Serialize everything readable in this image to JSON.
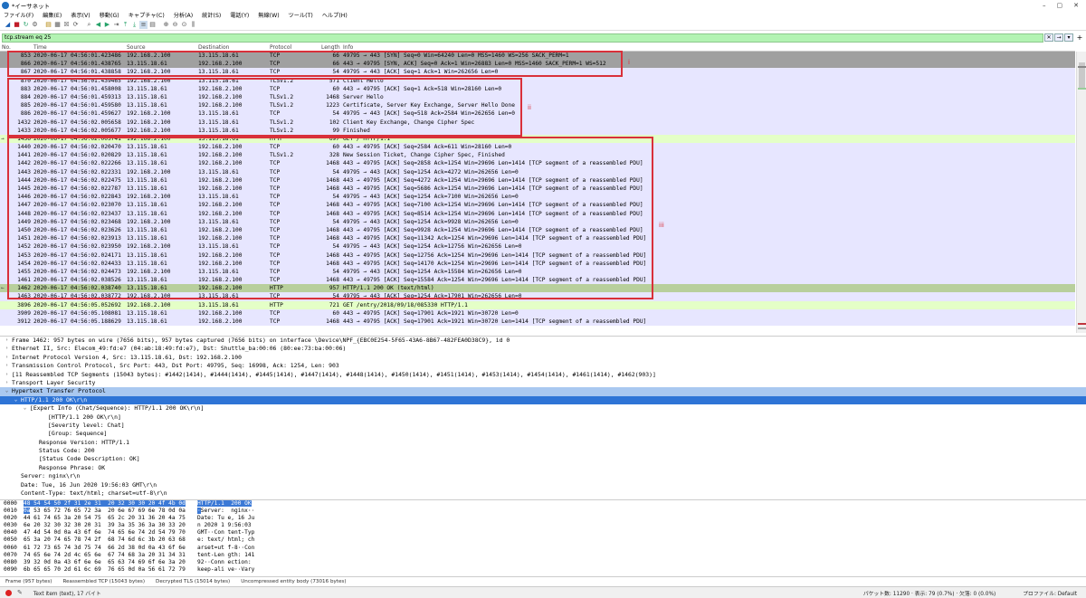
{
  "window": {
    "title": "*イーサネット",
    "controls": [
      "–",
      "▢",
      "✕"
    ]
  },
  "menu": [
    "ファイル(F)",
    "編集(E)",
    "表示(V)",
    "移動(G)",
    "キャプチャ(C)",
    "分析(A)",
    "統計(S)",
    "電話(Y)",
    "無線(W)",
    "ツール(T)",
    "ヘルプ(H)"
  ],
  "filter": {
    "value": "tcp.stream eq 25",
    "expression_label": "+"
  },
  "columns": {
    "no": "No.",
    "time": "Time",
    "source": "Source",
    "destination": "Destination",
    "protocol": "Protocol",
    "length": "Length",
    "info": "Info"
  },
  "colors": {
    "tcp_syn_row": "#a0a0a0",
    "tcp_row": "#e7e6ff",
    "http_row": "#e4ffc7",
    "http_selected": "#b8cf9c",
    "annotation": "#d9303a",
    "filter_ok": "#b3f3b3",
    "detail_selected": "#2e74d6",
    "detail_highlight": "#a9c8f0"
  },
  "packets": [
    {
      "mark": "",
      "no": "853",
      "time": "2020-06-17 04:56:01.423486",
      "src": "192.168.2.100",
      "dst": "13.115.18.61",
      "proto": "TCP",
      "len": "66",
      "info": "49795 → 443 [SYN] Seq=0 Win=64240 Len=0 MSS=1460 WS=256 SACK_PERM=1",
      "bg": "#a0a0a0"
    },
    {
      "mark": "",
      "no": "866",
      "time": "2020-06-17 04:56:01.438765",
      "src": "13.115.18.61",
      "dst": "192.168.2.100",
      "proto": "TCP",
      "len": "66",
      "info": "443 → 49795 [SYN, ACK] Seq=0 Ack=1 Win=26883 Len=0 MSS=1460 SACK_PERM=1 WS=512",
      "bg": "#a0a0a0"
    },
    {
      "mark": "",
      "no": "867",
      "time": "2020-06-17 04:56:01.438858",
      "src": "192.168.2.100",
      "dst": "13.115.18.61",
      "proto": "TCP",
      "len": "54",
      "info": "49795 → 443 [ACK] Seq=1 Ack=1 Win=262656 Len=0",
      "bg": "#e7e6ff"
    },
    {
      "mark": "",
      "no": "870",
      "time": "2020-06-17 04:56:01.439465",
      "src": "192.168.2.100",
      "dst": "13.115.18.61",
      "proto": "TLSv1.2",
      "len": "571",
      "info": "Client Hello",
      "bg": "#e7e6ff"
    },
    {
      "mark": "",
      "no": "883",
      "time": "2020-06-17 04:56:01.458008",
      "src": "13.115.18.61",
      "dst": "192.168.2.100",
      "proto": "TCP",
      "len": "60",
      "info": "443 → 49795 [ACK] Seq=1 Ack=518 Win=28160 Len=0",
      "bg": "#e7e6ff"
    },
    {
      "mark": "",
      "no": "884",
      "time": "2020-06-17 04:56:01.459313",
      "src": "13.115.18.61",
      "dst": "192.168.2.100",
      "proto": "TLSv1.2",
      "len": "1468",
      "info": "Server Hello",
      "bg": "#e7e6ff"
    },
    {
      "mark": "",
      "no": "885",
      "time": "2020-06-17 04:56:01.459580",
      "src": "13.115.18.61",
      "dst": "192.168.2.100",
      "proto": "TLSv1.2",
      "len": "1223",
      "info": "Certificate, Server Key Exchange, Server Hello Done",
      "bg": "#e7e6ff"
    },
    {
      "mark": "",
      "no": "886",
      "time": "2020-06-17 04:56:01.459627",
      "src": "192.168.2.100",
      "dst": "13.115.18.61",
      "proto": "TCP",
      "len": "54",
      "info": "49795 → 443 [ACK] Seq=518 Ack=2584 Win=262656 Len=0",
      "bg": "#e7e6ff"
    },
    {
      "mark": "",
      "no": "1432",
      "time": "2020-06-17 04:56:02.005658",
      "src": "192.168.2.100",
      "dst": "13.115.18.61",
      "proto": "TLSv1.2",
      "len": "102",
      "info": "Client Key Exchange, Change Cipher Spec",
      "bg": "#e7e6ff"
    },
    {
      "mark": "",
      "no": "1433",
      "time": "2020-06-17 04:56:02.005677",
      "src": "192.168.2.100",
      "dst": "13.115.18.61",
      "proto": "TLSv1.2",
      "len": "99",
      "info": "Finished",
      "bg": "#e7e6ff"
    },
    {
      "mark": "→",
      "no": "1436",
      "time": "2020-06-17 04:56:02.005741",
      "src": "192.168.2.100",
      "dst": "13.115.18.61",
      "proto": "HTTP",
      "len": "697",
      "info": "GET / HTTP/1.1",
      "bg": "#e4ffc7"
    },
    {
      "mark": "",
      "no": "1440",
      "time": "2020-06-17 04:56:02.020470",
      "src": "13.115.18.61",
      "dst": "192.168.2.100",
      "proto": "TCP",
      "len": "60",
      "info": "443 → 49795 [ACK] Seq=2584 Ack=611 Win=28160 Len=0",
      "bg": "#e7e6ff"
    },
    {
      "mark": "",
      "no": "1441",
      "time": "2020-06-17 04:56:02.020829",
      "src": "13.115.18.61",
      "dst": "192.168.2.100",
      "proto": "TLSv1.2",
      "len": "328",
      "info": "New Session Ticket, Change Cipher Spec, Finished",
      "bg": "#e7e6ff"
    },
    {
      "mark": "",
      "no": "1442",
      "time": "2020-06-17 04:56:02.022266",
      "src": "13.115.18.61",
      "dst": "192.168.2.100",
      "proto": "TCP",
      "len": "1468",
      "info": "443 → 49795 [ACK] Seq=2858 Ack=1254 Win=29696 Len=1414 [TCP segment of a reassembled PDU]",
      "bg": "#e7e6ff"
    },
    {
      "mark": "",
      "no": "1443",
      "time": "2020-06-17 04:56:02.022331",
      "src": "192.168.2.100",
      "dst": "13.115.18.61",
      "proto": "TCP",
      "len": "54",
      "info": "49795 → 443 [ACK] Seq=1254 Ack=4272 Win=262656 Len=0",
      "bg": "#e7e6ff"
    },
    {
      "mark": "",
      "no": "1444",
      "time": "2020-06-17 04:56:02.022475",
      "src": "13.115.18.61",
      "dst": "192.168.2.100",
      "proto": "TCP",
      "len": "1468",
      "info": "443 → 49795 [ACK] Seq=4272 Ack=1254 Win=29696 Len=1414 [TCP segment of a reassembled PDU]",
      "bg": "#e7e6ff"
    },
    {
      "mark": "",
      "no": "1445",
      "time": "2020-06-17 04:56:02.022787",
      "src": "13.115.18.61",
      "dst": "192.168.2.100",
      "proto": "TCP",
      "len": "1468",
      "info": "443 → 49795 [ACK] Seq=5686 Ack=1254 Win=29696 Len=1414 [TCP segment of a reassembled PDU]",
      "bg": "#e7e6ff"
    },
    {
      "mark": "",
      "no": "1446",
      "time": "2020-06-17 04:56:02.022843",
      "src": "192.168.2.100",
      "dst": "13.115.18.61",
      "proto": "TCP",
      "len": "54",
      "info": "49795 → 443 [ACK] Seq=1254 Ack=7100 Win=262656 Len=0",
      "bg": "#e7e6ff"
    },
    {
      "mark": "",
      "no": "1447",
      "time": "2020-06-17 04:56:02.023070",
      "src": "13.115.18.61",
      "dst": "192.168.2.100",
      "proto": "TCP",
      "len": "1468",
      "info": "443 → 49795 [ACK] Seq=7100 Ack=1254 Win=29696 Len=1414 [TCP segment of a reassembled PDU]",
      "bg": "#e7e6ff"
    },
    {
      "mark": "",
      "no": "1448",
      "time": "2020-06-17 04:56:02.023437",
      "src": "13.115.18.61",
      "dst": "192.168.2.100",
      "proto": "TCP",
      "len": "1468",
      "info": "443 → 49795 [ACK] Seq=8514 Ack=1254 Win=29696 Len=1414 [TCP segment of a reassembled PDU]",
      "bg": "#e7e6ff"
    },
    {
      "mark": "",
      "no": "1449",
      "time": "2020-06-17 04:56:02.023468",
      "src": "192.168.2.100",
      "dst": "13.115.18.61",
      "proto": "TCP",
      "len": "54",
      "info": "49795 → 443 [ACK] Seq=1254 Ack=9928 Win=262656 Len=0",
      "bg": "#e7e6ff"
    },
    {
      "mark": "",
      "no": "1450",
      "time": "2020-06-17 04:56:02.023626",
      "src": "13.115.18.61",
      "dst": "192.168.2.100",
      "proto": "TCP",
      "len": "1468",
      "info": "443 → 49795 [ACK] Seq=9928 Ack=1254 Win=29696 Len=1414 [TCP segment of a reassembled PDU]",
      "bg": "#e7e6ff"
    },
    {
      "mark": "",
      "no": "1451",
      "time": "2020-06-17 04:56:02.023913",
      "src": "13.115.18.61",
      "dst": "192.168.2.100",
      "proto": "TCP",
      "len": "1468",
      "info": "443 → 49795 [ACK] Seq=11342 Ack=1254 Win=29696 Len=1414 [TCP segment of a reassembled PDU]",
      "bg": "#e7e6ff"
    },
    {
      "mark": "",
      "no": "1452",
      "time": "2020-06-17 04:56:02.023950",
      "src": "192.168.2.100",
      "dst": "13.115.18.61",
      "proto": "TCP",
      "len": "54",
      "info": "49795 → 443 [ACK] Seq=1254 Ack=12756 Win=262656 Len=0",
      "bg": "#e7e6ff"
    },
    {
      "mark": "",
      "no": "1453",
      "time": "2020-06-17 04:56:02.024171",
      "src": "13.115.18.61",
      "dst": "192.168.2.100",
      "proto": "TCP",
      "len": "1468",
      "info": "443 → 49795 [ACK] Seq=12756 Ack=1254 Win=29696 Len=1414 [TCP segment of a reassembled PDU]",
      "bg": "#e7e6ff"
    },
    {
      "mark": "",
      "no": "1454",
      "time": "2020-06-17 04:56:02.024433",
      "src": "13.115.18.61",
      "dst": "192.168.2.100",
      "proto": "TCP",
      "len": "1468",
      "info": "443 → 49795 [ACK] Seq=14170 Ack=1254 Win=29696 Len=1414 [TCP segment of a reassembled PDU]",
      "bg": "#e7e6ff"
    },
    {
      "mark": "",
      "no": "1455",
      "time": "2020-06-17 04:56:02.024473",
      "src": "192.168.2.100",
      "dst": "13.115.18.61",
      "proto": "TCP",
      "len": "54",
      "info": "49795 → 443 [ACK] Seq=1254 Ack=15584 Win=262656 Len=0",
      "bg": "#e7e6ff"
    },
    {
      "mark": "",
      "no": "1461",
      "time": "2020-06-17 04:56:02.038526",
      "src": "13.115.18.61",
      "dst": "192.168.2.100",
      "proto": "TCP",
      "len": "1468",
      "info": "443 → 49795 [ACK] Seq=15584 Ack=1254 Win=29696 Len=1414 [TCP segment of a reassembled PDU]",
      "bg": "#e7e6ff"
    },
    {
      "mark": "←",
      "no": "1462",
      "time": "2020-06-17 04:56:02.038740",
      "src": "13.115.18.61",
      "dst": "192.168.2.100",
      "proto": "HTTP",
      "len": "957",
      "info": "HTTP/1.1 200 OK  (text/html)",
      "bg": "#b8cf9c"
    },
    {
      "mark": "",
      "no": "1463",
      "time": "2020-06-17 04:56:02.038772",
      "src": "192.168.2.100",
      "dst": "13.115.18.61",
      "proto": "TCP",
      "len": "54",
      "info": "49795 → 443 [ACK] Seq=1254 Ack=17901 Win=262656 Len=0",
      "bg": "#e7e6ff"
    },
    {
      "mark": "",
      "no": "3896",
      "time": "2020-06-17 04:56:05.052692",
      "src": "192.168.2.100",
      "dst": "13.115.18.61",
      "proto": "HTTP",
      "len": "721",
      "info": "GET /entry/2018/09/18/085330 HTTP/1.1",
      "bg": "#e4ffc7"
    },
    {
      "mark": "",
      "no": "3909",
      "time": "2020-06-17 04:56:05.108081",
      "src": "13.115.18.61",
      "dst": "192.168.2.100",
      "proto": "TCP",
      "len": "60",
      "info": "443 → 49795 [ACK] Seq=17901 Ack=1921 Win=30720 Len=0",
      "bg": "#e7e6ff"
    },
    {
      "mark": "",
      "no": "3912",
      "time": "2020-06-17 04:56:05.188629",
      "src": "13.115.18.61",
      "dst": "192.168.2.100",
      "proto": "TCP",
      "len": "1468",
      "info": "443 → 49795 [ACK] Seq=17901 Ack=1921 Win=30720 Len=1414 [TCP segment of a reassembled PDU]",
      "bg": "#e7e6ff"
    }
  ],
  "annotations": [
    {
      "label": "i"
    },
    {
      "label": "ii"
    },
    {
      "label": "iii"
    }
  ],
  "details": [
    {
      "tw": "›",
      "indent": 0,
      "text": "Frame 1462: 957 bytes on wire (7656 bits), 957 bytes captured (7656 bits) on interface \\Device\\NPF_{EBC0E254-5F65-43A6-8B67-482FEA0D38C9}, id 0",
      "style": ""
    },
    {
      "tw": "›",
      "indent": 0,
      "text": "Ethernet II, Src: Elecom_49:fd:e7 (04:ab:18:49:fd:e7), Dst: Shuttle_ba:00:06 (80:ee:73:ba:00:06)",
      "style": ""
    },
    {
      "tw": "›",
      "indent": 0,
      "text": "Internet Protocol Version 4, Src: 13.115.18.61, Dst: 192.168.2.100",
      "style": ""
    },
    {
      "tw": "›",
      "indent": 0,
      "text": "Transmission Control Protocol, Src Port: 443, Dst Port: 49795, Seq: 16998, Ack: 1254, Len: 903",
      "style": ""
    },
    {
      "tw": "›",
      "indent": 0,
      "text": "[11 Reassembled TCP Segments (15043 bytes): #1442(1414), #1444(1414), #1445(1414), #1447(1414), #1448(1414), #1450(1414), #1451(1414), #1453(1414), #1454(1414), #1461(1414), #1462(903)]",
      "style": ""
    },
    {
      "tw": "›",
      "indent": 0,
      "text": "Transport Layer Security",
      "style": ""
    },
    {
      "tw": "⌄",
      "indent": 0,
      "text": "Hypertext Transfer Protocol",
      "style": "hi"
    },
    {
      "tw": "⌄",
      "indent": 1,
      "text": "HTTP/1.1 200 OK\\r\\n",
      "style": "sel"
    },
    {
      "tw": "⌄",
      "indent": 2,
      "text": "[Expert Info (Chat/Sequence): HTTP/1.1 200 OK\\r\\n]",
      "style": ""
    },
    {
      "tw": "",
      "indent": 4,
      "text": "[HTTP/1.1 200 OK\\r\\n]",
      "style": ""
    },
    {
      "tw": "",
      "indent": 4,
      "text": "[Severity level: Chat]",
      "style": ""
    },
    {
      "tw": "",
      "indent": 4,
      "text": "[Group: Sequence]",
      "style": ""
    },
    {
      "tw": "",
      "indent": 3,
      "text": "Response Version: HTTP/1.1",
      "style": ""
    },
    {
      "tw": "",
      "indent": 3,
      "text": "Status Code: 200",
      "style": ""
    },
    {
      "tw": "",
      "indent": 3,
      "text": "[Status Code Description: OK]",
      "style": ""
    },
    {
      "tw": "",
      "indent": 3,
      "text": "Response Phrase: OK",
      "style": ""
    },
    {
      "tw": "",
      "indent": 1,
      "text": "Server: nginx\\r\\n",
      "style": ""
    },
    {
      "tw": "",
      "indent": 1,
      "text": "Date: Tue, 16 Jun 2020 19:56:03 GMT\\r\\n",
      "style": ""
    },
    {
      "tw": "",
      "indent": 1,
      "text": "Content-Type: text/html; charset=utf-8\\r\\n",
      "style": ""
    }
  ],
  "bytes": [
    {
      "off": "0000",
      "hl_hex": "48 54 54 50 2f 31 2e 31  20 32 30 30 20 4f 4b 0d",
      "hex": "",
      "hl_asc": "HTTP/1.1  200 OK",
      "asc": ""
    },
    {
      "off": "0010",
      "hl_hex": "0a",
      "hex": " 53 65 72 76 65 72 3a  20 6e 67 69 6e 78 0d 0a",
      "hl_asc": "·",
      "asc": "Server:  nginx··"
    },
    {
      "off": "0020",
      "hl_hex": "",
      "hex": "44 61 74 65 3a 20 54 75  65 2c 20 31 36 20 4a 75",
      "hl_asc": "",
      "asc": "Date: Tu e, 16 Ju"
    },
    {
      "off": "0030",
      "hl_hex": "",
      "hex": "6e 20 32 30 32 30 20 31  39 3a 35 36 3a 30 33 20",
      "hl_asc": "",
      "asc": "n 2020 1 9:56:03"
    },
    {
      "off": "0040",
      "hl_hex": "",
      "hex": "47 4d 54 0d 0a 43 6f 6e  74 65 6e 74 2d 54 79 70",
      "hl_asc": "",
      "asc": "GMT··Con tent-Typ"
    },
    {
      "off": "0050",
      "hl_hex": "",
      "hex": "65 3a 20 74 65 78 74 2f  68 74 6d 6c 3b 20 63 68",
      "hl_asc": "",
      "asc": "e: text/ html; ch"
    },
    {
      "off": "0060",
      "hl_hex": "",
      "hex": "61 72 73 65 74 3d 75 74  66 2d 38 0d 0a 43 6f 6e",
      "hl_asc": "",
      "asc": "arset=ut f-8··Con"
    },
    {
      "off": "0070",
      "hl_hex": "",
      "hex": "74 65 6e 74 2d 4c 65 6e  67 74 68 3a 20 31 34 31",
      "hl_asc": "",
      "asc": "tent-Len gth: 141"
    },
    {
      "off": "0080",
      "hl_hex": "",
      "hex": "39 32 0d 0a 43 6f 6e 6e  65 63 74 69 6f 6e 3a 20",
      "hl_asc": "",
      "asc": "92··Conn ection:"
    },
    {
      "off": "0090",
      "hl_hex": "",
      "hex": "6b 65 65 70 2d 61 6c 69  76 65 0d 0a 56 61 72 79",
      "hl_asc": "",
      "asc": "keep-ali ve··Vary"
    }
  ],
  "byte_tabs": [
    "Frame (957 bytes)",
    "Reassembled TCP (15043 bytes)",
    "Decrypted TLS (15014 bytes)",
    "Uncompressed entity body (73016 bytes)"
  ],
  "status": {
    "item": "Text item (text), 17 バイト",
    "packets": "パケット数: 11290 · 表示: 79 (0.7%) · 欠落: 0 (0.0%)",
    "profile": "プロファイル: Default"
  }
}
